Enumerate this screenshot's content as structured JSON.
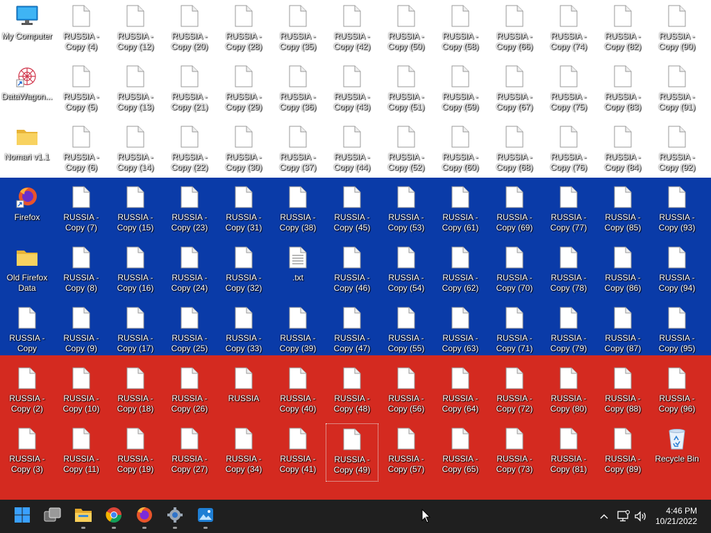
{
  "desktop": {
    "flag_colors": [
      "#ffffff",
      "#0a3ba8",
      "#d42a20"
    ],
    "columns": [
      [
        {
          "label": "My Computer",
          "icon": "computer-icon"
        },
        {
          "label": "DataWagon...",
          "icon": "datawagon-shortcut-icon"
        },
        {
          "label": "Nomari v1.1",
          "icon": "folder-icon"
        },
        {
          "label": "Firefox",
          "icon": "firefox-shortcut-icon"
        },
        {
          "label": "Old Firefox Data",
          "icon": "folder-icon"
        },
        {
          "label": "RUSSIA - Copy",
          "icon": "file-icon"
        },
        {
          "label": "RUSSIA - Copy (2)",
          "icon": "file-icon"
        },
        {
          "label": "RUSSIA - Copy (3)",
          "icon": "file-icon"
        }
      ],
      [
        {
          "label": "RUSSIA - Copy (4)",
          "icon": "file-icon"
        },
        {
          "label": "RUSSIA - Copy (5)",
          "icon": "file-icon"
        },
        {
          "label": "RUSSIA - Copy (6)",
          "icon": "file-icon"
        },
        {
          "label": "RUSSIA - Copy (7)",
          "icon": "file-icon"
        },
        {
          "label": "RUSSIA - Copy (8)",
          "icon": "file-icon"
        },
        {
          "label": "RUSSIA - Copy (9)",
          "icon": "file-icon"
        },
        {
          "label": "RUSSIA - Copy (10)",
          "icon": "file-icon"
        },
        {
          "label": "RUSSIA - Copy (11)",
          "icon": "file-icon"
        }
      ],
      [
        {
          "label": "RUSSIA - Copy (12)",
          "icon": "file-icon"
        },
        {
          "label": "RUSSIA - Copy (13)",
          "icon": "file-icon"
        },
        {
          "label": "RUSSIA - Copy (14)",
          "icon": "file-icon"
        },
        {
          "label": "RUSSIA - Copy (15)",
          "icon": "file-icon"
        },
        {
          "label": "RUSSIA - Copy (16)",
          "icon": "file-icon"
        },
        {
          "label": "RUSSIA - Copy (17)",
          "icon": "file-icon"
        },
        {
          "label": "RUSSIA - Copy (18)",
          "icon": "file-icon"
        },
        {
          "label": "RUSSIA - Copy (19)",
          "icon": "file-icon"
        }
      ],
      [
        {
          "label": "RUSSIA - Copy (20)",
          "icon": "file-icon"
        },
        {
          "label": "RUSSIA - Copy (21)",
          "icon": "file-icon"
        },
        {
          "label": "RUSSIA - Copy (22)",
          "icon": "file-icon"
        },
        {
          "label": "RUSSIA - Copy (23)",
          "icon": "file-icon"
        },
        {
          "label": "RUSSIA - Copy (24)",
          "icon": "file-icon"
        },
        {
          "label": "RUSSIA - Copy (25)",
          "icon": "file-icon"
        },
        {
          "label": "RUSSIA - Copy (26)",
          "icon": "file-icon"
        },
        {
          "label": "RUSSIA - Copy (27)",
          "icon": "file-icon"
        }
      ],
      [
        {
          "label": "RUSSIA - Copy (28)",
          "icon": "file-icon"
        },
        {
          "label": "RUSSIA - Copy (29)",
          "icon": "file-icon"
        },
        {
          "label": "RUSSIA - Copy (30)",
          "icon": "file-icon"
        },
        {
          "label": "RUSSIA - Copy (31)",
          "icon": "file-icon"
        },
        {
          "label": "RUSSIA - Copy (32)",
          "icon": "file-icon"
        },
        {
          "label": "RUSSIA - Copy (33)",
          "icon": "file-icon"
        },
        {
          "label": "RUSSIA",
          "icon": "file-icon"
        },
        {
          "label": "RUSSIA - Copy (34)",
          "icon": "file-icon"
        }
      ],
      [
        {
          "label": "RUSSIA - Copy (35)",
          "icon": "file-icon"
        },
        {
          "label": "RUSSIA - Copy (36)",
          "icon": "file-icon"
        },
        {
          "label": "RUSSIA - Copy (37)",
          "icon": "file-icon"
        },
        {
          "label": "RUSSIA - Copy (38)",
          "icon": "file-icon"
        },
        {
          "label": ".txt",
          "icon": "text-file-icon"
        },
        {
          "label": "RUSSIA - Copy (39)",
          "icon": "file-icon"
        },
        {
          "label": "RUSSIA - Copy (40)",
          "icon": "file-icon"
        },
        {
          "label": "RUSSIA - Copy (41)",
          "icon": "file-icon"
        }
      ],
      [
        {
          "label": "RUSSIA - Copy (42)",
          "icon": "file-icon"
        },
        {
          "label": "RUSSIA - Copy (43)",
          "icon": "file-icon"
        },
        {
          "label": "RUSSIA - Copy (44)",
          "icon": "file-icon"
        },
        {
          "label": "RUSSIA - Copy (45)",
          "icon": "file-icon"
        },
        {
          "label": "RUSSIA - Copy (46)",
          "icon": "file-icon"
        },
        {
          "label": "RUSSIA - Copy (47)",
          "icon": "file-icon"
        },
        {
          "label": "RUSSIA - Copy (48)",
          "icon": "file-icon"
        },
        {
          "label": "RUSSIA - Copy (49)",
          "icon": "file-icon",
          "selected": true
        }
      ],
      [
        {
          "label": "RUSSIA - Copy (50)",
          "icon": "file-icon"
        },
        {
          "label": "RUSSIA - Copy (51)",
          "icon": "file-icon"
        },
        {
          "label": "RUSSIA - Copy (52)",
          "icon": "file-icon"
        },
        {
          "label": "RUSSIA - Copy (53)",
          "icon": "file-icon"
        },
        {
          "label": "RUSSIA - Copy (54)",
          "icon": "file-icon"
        },
        {
          "label": "RUSSIA - Copy (55)",
          "icon": "file-icon"
        },
        {
          "label": "RUSSIA - Copy (56)",
          "icon": "file-icon"
        },
        {
          "label": "RUSSIA - Copy (57)",
          "icon": "file-icon"
        }
      ],
      [
        {
          "label": "RUSSIA - Copy (58)",
          "icon": "file-icon"
        },
        {
          "label": "RUSSIA - Copy (59)",
          "icon": "file-icon"
        },
        {
          "label": "RUSSIA - Copy (60)",
          "icon": "file-icon"
        },
        {
          "label": "RUSSIA - Copy (61)",
          "icon": "file-icon"
        },
        {
          "label": "RUSSIA - Copy (62)",
          "icon": "file-icon"
        },
        {
          "label": "RUSSIA - Copy (63)",
          "icon": "file-icon"
        },
        {
          "label": "RUSSIA - Copy (64)",
          "icon": "file-icon"
        },
        {
          "label": "RUSSIA - Copy (65)",
          "icon": "file-icon"
        }
      ],
      [
        {
          "label": "RUSSIA - Copy (66)",
          "icon": "file-icon"
        },
        {
          "label": "RUSSIA - Copy (67)",
          "icon": "file-icon"
        },
        {
          "label": "RUSSIA - Copy (68)",
          "icon": "file-icon"
        },
        {
          "label": "RUSSIA - Copy (69)",
          "icon": "file-icon"
        },
        {
          "label": "RUSSIA - Copy (70)",
          "icon": "file-icon"
        },
        {
          "label": "RUSSIA - Copy (71)",
          "icon": "file-icon"
        },
        {
          "label": "RUSSIA - Copy (72)",
          "icon": "file-icon"
        },
        {
          "label": "RUSSIA - Copy (73)",
          "icon": "file-icon"
        }
      ],
      [
        {
          "label": "RUSSIA - Copy (74)",
          "icon": "file-icon"
        },
        {
          "label": "RUSSIA - Copy (75)",
          "icon": "file-icon"
        },
        {
          "label": "RUSSIA - Copy (76)",
          "icon": "file-icon"
        },
        {
          "label": "RUSSIA - Copy (77)",
          "icon": "file-icon"
        },
        {
          "label": "RUSSIA - Copy (78)",
          "icon": "file-icon"
        },
        {
          "label": "RUSSIA - Copy (79)",
          "icon": "file-icon"
        },
        {
          "label": "RUSSIA - Copy (80)",
          "icon": "file-icon"
        },
        {
          "label": "RUSSIA - Copy (81)",
          "icon": "file-icon"
        }
      ],
      [
        {
          "label": "RUSSIA - Copy (82)",
          "icon": "file-icon"
        },
        {
          "label": "RUSSIA - Copy (83)",
          "icon": "file-icon"
        },
        {
          "label": "RUSSIA - Copy (84)",
          "icon": "file-icon"
        },
        {
          "label": "RUSSIA - Copy (85)",
          "icon": "file-icon"
        },
        {
          "label": "RUSSIA - Copy (86)",
          "icon": "file-icon"
        },
        {
          "label": "RUSSIA - Copy (87)",
          "icon": "file-icon"
        },
        {
          "label": "RUSSIA - Copy (88)",
          "icon": "file-icon"
        },
        {
          "label": "RUSSIA - Copy (89)",
          "icon": "file-icon"
        }
      ],
      [
        {
          "label": "RUSSIA - Copy (90)",
          "icon": "file-icon"
        },
        {
          "label": "RUSSIA - Copy (91)",
          "icon": "file-icon"
        },
        {
          "label": "RUSSIA - Copy (92)",
          "icon": "file-icon"
        },
        {
          "label": "RUSSIA - Copy (93)",
          "icon": "file-icon"
        },
        {
          "label": "RUSSIA - Copy (94)",
          "icon": "file-icon"
        },
        {
          "label": "RUSSIA - Copy (95)",
          "icon": "file-icon"
        },
        {
          "label": "RUSSIA - Copy (96)",
          "icon": "file-icon"
        },
        {
          "label": "Recycle Bin",
          "icon": "recycle-bin-icon"
        }
      ]
    ]
  },
  "taskbar": {
    "background": "#1f1f1f",
    "apps": [
      {
        "name": "start-button",
        "icon": "windows-logo-icon",
        "running": false
      },
      {
        "name": "task-view-button",
        "icon": "task-view-icon",
        "running": false
      },
      {
        "name": "file-explorer-button",
        "icon": "file-explorer-icon",
        "running": true
      },
      {
        "name": "chrome-button",
        "icon": "chrome-icon",
        "running": true
      },
      {
        "name": "firefox-button",
        "icon": "firefox-icon",
        "running": true
      },
      {
        "name": "settings-button",
        "icon": "settings-gear-icon",
        "running": true
      },
      {
        "name": "photos-button",
        "icon": "photos-icon",
        "running": true
      }
    ],
    "tray": {
      "icons": [
        "chevron-up-icon",
        "network-icon",
        "volume-icon"
      ],
      "time": "4:46 PM",
      "date": "10/21/2022"
    }
  }
}
